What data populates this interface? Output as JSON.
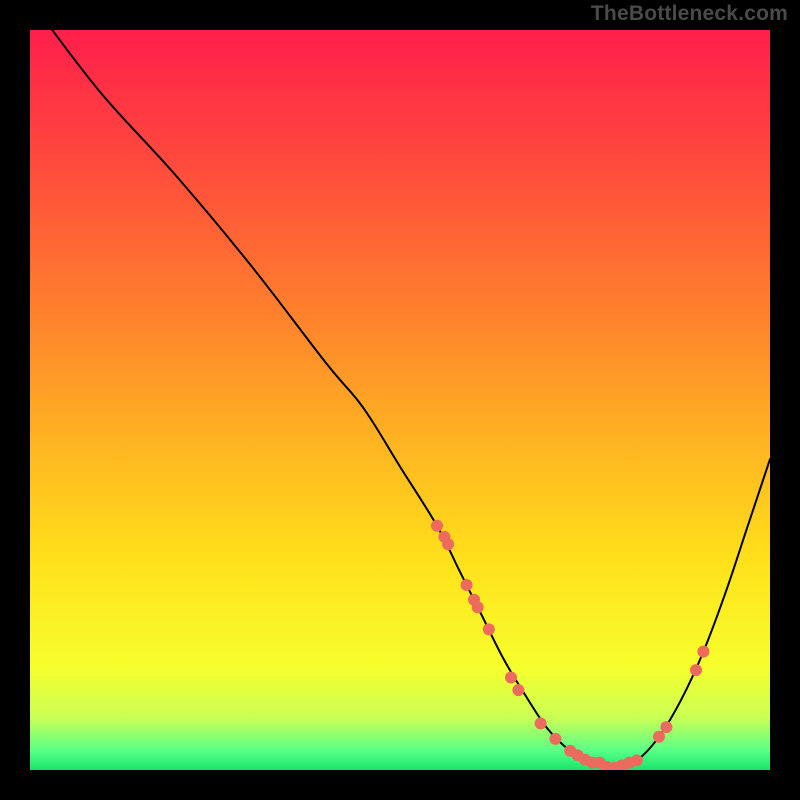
{
  "watermark": "TheBottleneck.com",
  "chart_data": {
    "type": "line",
    "title": "",
    "xlabel": "",
    "ylabel": "",
    "xlim": [
      0,
      100
    ],
    "ylim": [
      0,
      100
    ],
    "grid": false,
    "legend": false,
    "series": [
      {
        "name": "curve",
        "x": [
          3,
          10,
          20,
          30,
          40,
          45,
          50,
          55,
          58,
          61,
          64,
          67,
          70,
          73,
          76,
          79,
          82,
          85,
          88,
          91,
          94,
          97,
          100
        ],
        "y": [
          100,
          91,
          80,
          68,
          55,
          49,
          41,
          33,
          27,
          21,
          15,
          10,
          5.5,
          2.6,
          1.0,
          0.3,
          1.3,
          4.5,
          9.5,
          16,
          24,
          33,
          42
        ],
        "style": {
          "stroke": "#000000",
          "strokeWidth": 2,
          "fill": "none"
        }
      },
      {
        "name": "dots-left-cluster",
        "type": "scatter",
        "x": [
          55,
          56,
          56.5,
          59,
          60,
          60.5,
          62,
          65,
          66
        ],
        "y": [
          33,
          31.5,
          30.5,
          25,
          23,
          22,
          19,
          12.5,
          10.8
        ],
        "style": {
          "fill": "#ec6a5e",
          "r": 6
        }
      },
      {
        "name": "dots-bottom-cluster",
        "type": "scatter",
        "x": [
          69,
          71,
          73,
          74,
          75,
          76,
          77,
          78,
          79,
          80,
          81,
          82
        ],
        "y": [
          6.3,
          4.2,
          2.6,
          2.0,
          1.4,
          1.0,
          1.0,
          0.4,
          0.3,
          0.6,
          1.0,
          1.3
        ],
        "style": {
          "fill": "#ec6a5e",
          "r": 6
        }
      },
      {
        "name": "dots-right-cluster",
        "type": "scatter",
        "x": [
          85,
          86,
          90,
          91
        ],
        "y": [
          4.5,
          5.8,
          13.5,
          16
        ],
        "style": {
          "fill": "#ec6a5e",
          "r": 6
        }
      }
    ],
    "gradient_stops": [
      {
        "offset": 0.0,
        "color": "#ff1f4b"
      },
      {
        "offset": 0.18,
        "color": "#ff4a3d"
      },
      {
        "offset": 0.36,
        "color": "#ff7a2e"
      },
      {
        "offset": 0.55,
        "color": "#ffb222"
      },
      {
        "offset": 0.72,
        "color": "#ffe11a"
      },
      {
        "offset": 0.86,
        "color": "#f6ff2b"
      },
      {
        "offset": 0.93,
        "color": "#c9ff55"
      },
      {
        "offset": 0.975,
        "color": "#55ff88"
      },
      {
        "offset": 1.0,
        "color": "#18e56a"
      }
    ]
  }
}
